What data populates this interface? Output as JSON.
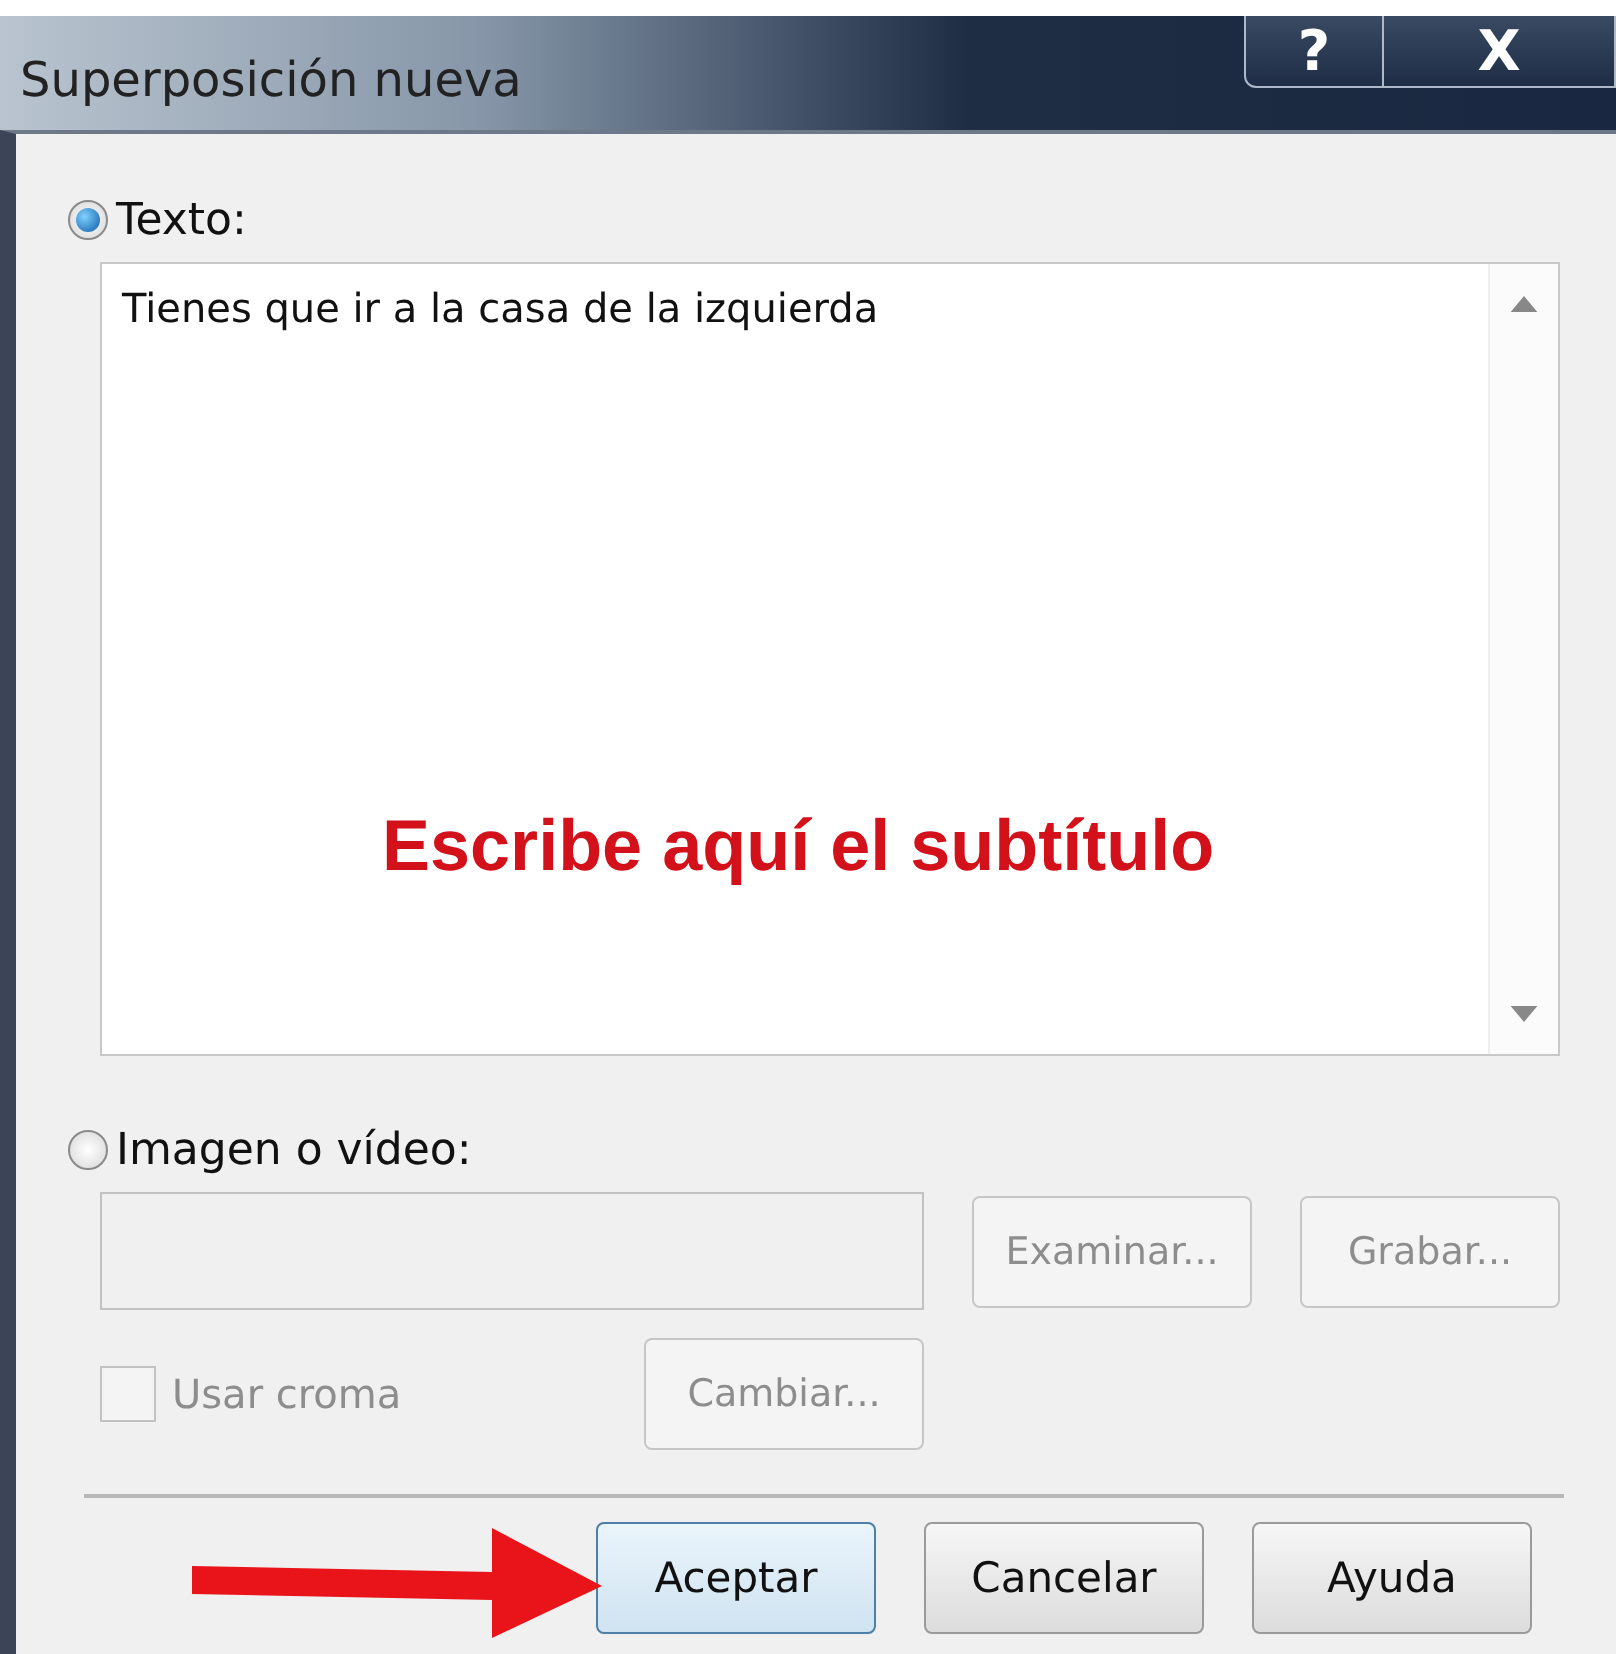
{
  "window": {
    "title": "Superposición nueva",
    "help_button": "?",
    "close_button": "X"
  },
  "text_option": {
    "label": "Texto:",
    "selected": true,
    "value": "Tienes que ir a la casa de la izquierda"
  },
  "annotation": {
    "text": "Escribe aquí el subtítulo"
  },
  "media_option": {
    "label": "Imagen o vídeo:",
    "selected": false
  },
  "media_buttons": [
    {
      "label": "Examinar...",
      "disabled": true
    },
    {
      "label": "Grabar...",
      "disabled": true
    }
  ],
  "chroma": {
    "label": "Usar croma",
    "checked": false,
    "disabled": true
  },
  "chroma_button": {
    "label": "Cambiar...",
    "disabled": true
  },
  "buttons": [
    {
      "label": "Aceptar",
      "pointed": true
    },
    {
      "label": "Cancelar",
      "pointed": false
    },
    {
      "label": "Ayuda",
      "pointed": false
    }
  ]
}
